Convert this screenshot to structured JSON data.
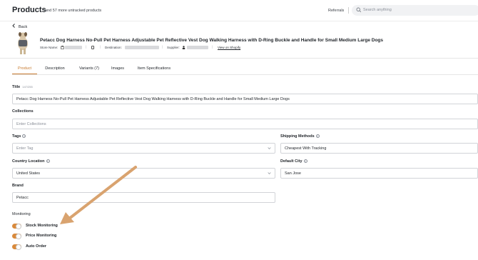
{
  "header": {
    "title": "Products",
    "subtitle": "and 57 more untracked products",
    "referrals": "Referrals",
    "search_placeholder": "Search anything"
  },
  "back_label": "Back",
  "product": {
    "title": "Petacc Dog Harness No-Pull Pet Harness Adjustable Pet Reflective Vest Dog Walking Harness with D-Ring Buckle and Handle for Small Medium Large Dogs",
    "store_label": "Store Name:",
    "destination_label": "Destination:",
    "supplier_label": "Supplier:",
    "view_link": "View on Shopify"
  },
  "tabs": [
    {
      "label": "Product",
      "active": true
    },
    {
      "label": "Description",
      "active": false
    },
    {
      "label": "Variants (7)",
      "active": false
    },
    {
      "label": "Images",
      "active": false
    },
    {
      "label": "Item Specifications",
      "active": false
    }
  ],
  "form": {
    "title_label": "Title",
    "title_count": "147/255",
    "title_value": "Petacc Dog Harness No-Pull Pet Harness Adjustable Pet Reflective Vest Dog Walking Harness with D-Ring Buckle and Handle for Small Medium Large Dogs",
    "collections_label": "Collections",
    "collections_placeholder": "Enter Collections",
    "tags_label": "Tags",
    "tags_placeholder": "Enter Tag",
    "shipping_label": "Shipping Methods",
    "shipping_value": "Cheapest With Tracking",
    "country_label": "Country Location",
    "country_value": "United States",
    "city_label": "Default City",
    "city_value": "San Jose",
    "brand_label": "Brand",
    "brand_value": "Petacc"
  },
  "monitoring": {
    "heading": "Monitoring",
    "toggles": [
      {
        "label": "Stock Monitoring",
        "on": true
      },
      {
        "label": "Price Monitoring",
        "on": true
      },
      {
        "label": "Auto Order",
        "on": true
      }
    ]
  },
  "colors": {
    "accent": "#d98a3c",
    "annotation_arrow": "#d9a36f"
  },
  "icons": [
    "chevron-left-icon",
    "search-icon",
    "info-icon",
    "chevron-down-icon",
    "store-icon",
    "copy-icon",
    "supplier-icon"
  ]
}
